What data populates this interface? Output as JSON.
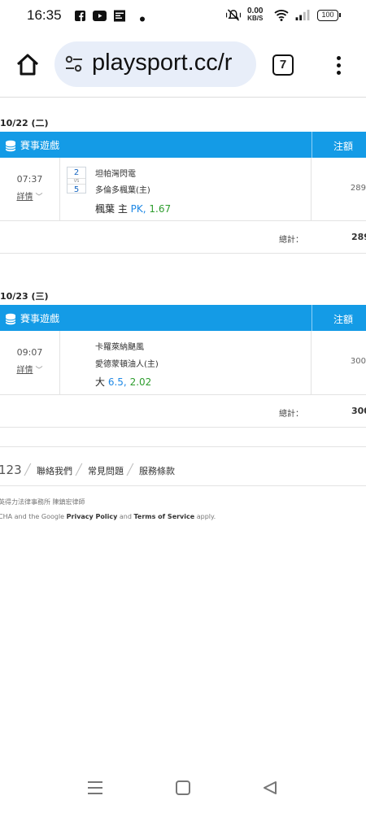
{
  "status_bar": {
    "time": "16:35",
    "net_speed": "0.00",
    "net_unit": "KB/S",
    "battery": "100",
    "icons": [
      "facebook-icon",
      "youtube-icon",
      "news-icon",
      "dot-icon",
      "mute-icon",
      "wifi-icon",
      "signal-icon",
      "battery-icon"
    ]
  },
  "browser": {
    "url": "playsport.cc/r",
    "tab_count": "7",
    "icons": [
      "home-icon",
      "tune-icon",
      "tabs-icon",
      "more-vert-icon"
    ]
  },
  "table_header": {
    "game": "賽事遊戲",
    "bet": "注額",
    "color": "#149be6"
  },
  "days": [
    {
      "date": "10/22 (二)",
      "match": {
        "time": "07:37",
        "detail_label": "詳情",
        "score_home": "2",
        "vs": "VS",
        "score_away": "5",
        "team_away": "坦帕灣閃電",
        "team_home": "多倫多楓葉(主)",
        "pick_side": "楓葉 主",
        "pick_line": "PK,",
        "pick_odds": "1.67",
        "bet": "289"
      },
      "total_label": "總計：",
      "total_value": "289"
    },
    {
      "date": "10/23 (三)",
      "match": {
        "time": "09:07",
        "detail_label": "詳情",
        "team_away": "卡羅萊納颶風",
        "team_home": "愛德蒙頓油人(主)",
        "pick_side": "大",
        "pick_line": "6.5,",
        "pick_odds": "2.02",
        "bet": "300"
      },
      "total_label": "總計：",
      "total_value": "300"
    }
  ],
  "footer": {
    "partial": "123",
    "links": [
      "聯絡我們",
      "常見問題",
      "服務條款"
    ],
    "legal_line1": "英得力法律事務所 陳鎮宏律師",
    "legal_line2_prefix": "CHA and the Google",
    "privacy": "Privacy Policy",
    "and": "and",
    "terms": "Terms of Service",
    "apply": "apply."
  },
  "nav_bar": {
    "icons": [
      "recent-apps-icon",
      "home-nav-icon",
      "back-nav-icon"
    ]
  }
}
